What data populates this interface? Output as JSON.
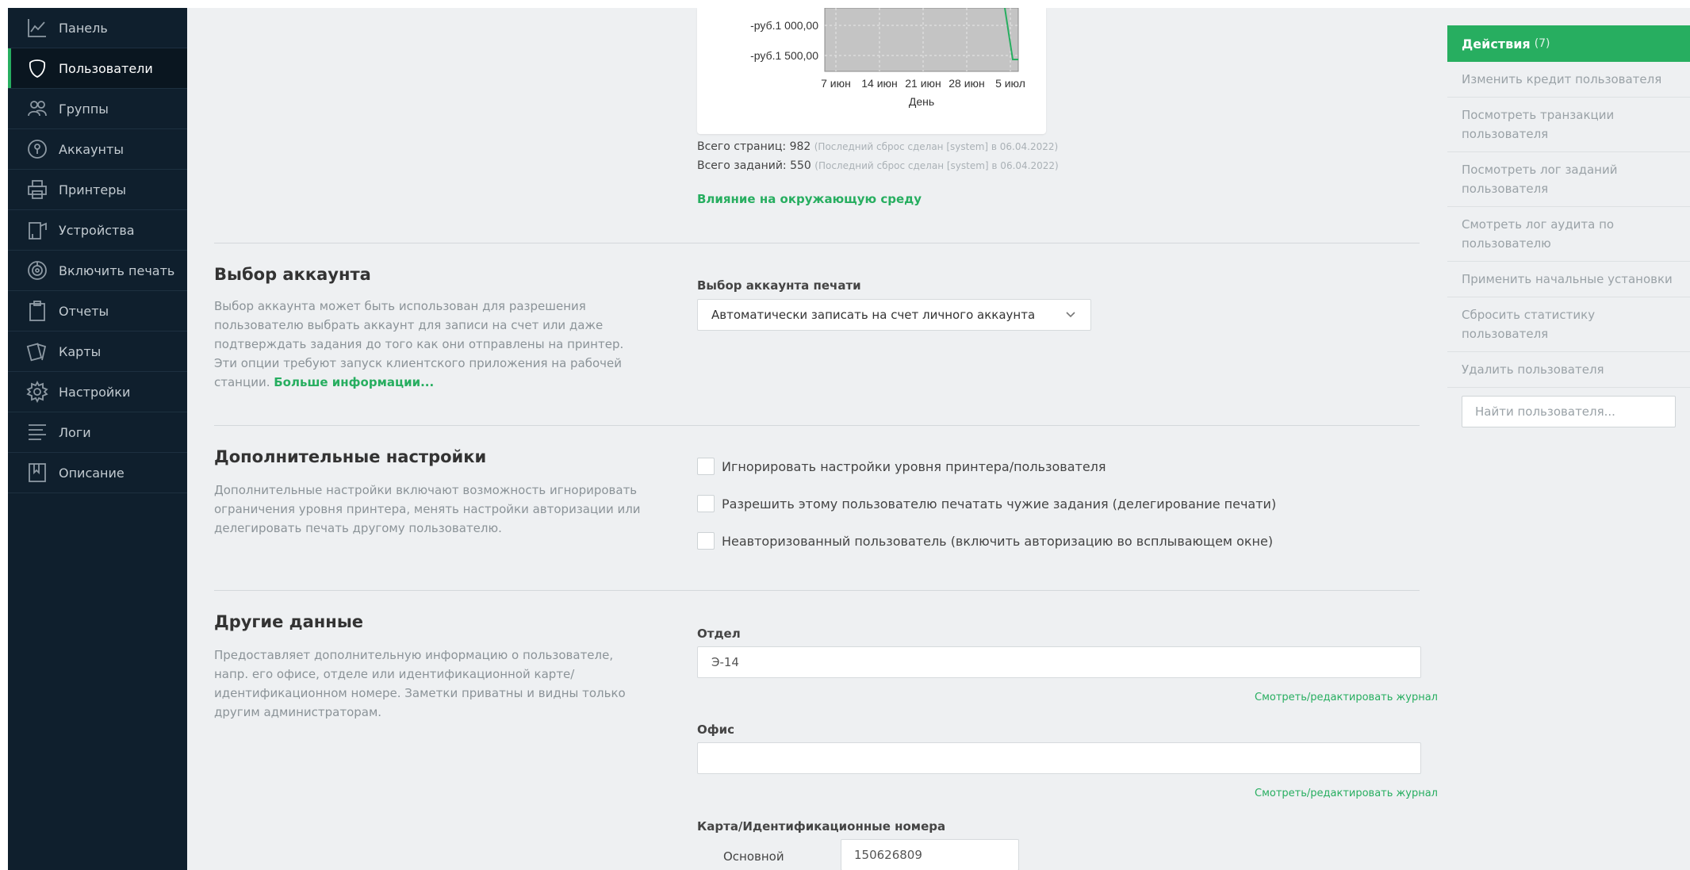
{
  "sidebar": {
    "items": [
      {
        "label": "Панель",
        "icon": "dashboard-icon"
      },
      {
        "label": "Пользователи",
        "icon": "users-icon"
      },
      {
        "label": "Группы",
        "icon": "groups-icon"
      },
      {
        "label": "Аккаунты",
        "icon": "accounts-icon"
      },
      {
        "label": "Принтеры",
        "icon": "printer-icon"
      },
      {
        "label": "Устройства",
        "icon": "devices-icon"
      },
      {
        "label": "Включить печать",
        "icon": "release-print-icon"
      },
      {
        "label": "Отчеты",
        "icon": "reports-icon"
      },
      {
        "label": "Карты",
        "icon": "cards-icon"
      },
      {
        "label": "Настройки",
        "icon": "settings-icon"
      },
      {
        "label": "Логи",
        "icon": "logs-icon"
      },
      {
        "label": "Описание",
        "icon": "about-icon"
      }
    ],
    "active": "Пользователи"
  },
  "chart_data": {
    "type": "line",
    "xlabel": "День",
    "x_ticks": [
      "7 июн",
      "14 июн",
      "21 июн",
      "28 июн",
      "5 июл"
    ],
    "y_ticks": [
      "-руб.1 000,00",
      "-руб.1 500,00"
    ],
    "series_color": "#27ae60"
  },
  "stats": {
    "pages_label": "Всего страниц:",
    "pages_value": "982",
    "pages_note": "(Последний сброс сделан [system] в 06.04.2022)",
    "jobs_label": "Всего заданий:",
    "jobs_value": "550",
    "jobs_note": "(Последний сброс сделан [system] в 06.04.2022)",
    "env_link": "Влияние на окружающую среду"
  },
  "account_selection": {
    "title": "Выбор аккаунта",
    "description": "Выбор аккаунта может быть использован для разрешения пользователю выбрать аккаунт для записи на счет или даже подтверждать задания до того как они отправлены на принтер. Эти опции требуют запуск клиентского приложения на рабочей станции.",
    "more_link": "Больше информации...",
    "field_label": "Выбор аккаунта печати",
    "selected_value": "Автоматически записать на счет личного аккаунта"
  },
  "advanced": {
    "title": "Дополнительные настройки",
    "description": "Дополнительные настройки включают возможность игнорировать ограничения уровня принтера, менять настройки авторизации или делегировать печать другому пользователю.",
    "checkboxes": [
      {
        "label": "Игнорировать настройки уровня принтера/пользователя",
        "checked": false
      },
      {
        "label": "Разрешить этому пользователю печатать чужие задания (делегирование печати)",
        "checked": false
      },
      {
        "label": "Неавторизованный пользователь (включить авторизацию во всплывающем окне)",
        "checked": false
      }
    ]
  },
  "other": {
    "title": "Другие данные",
    "description": "Предоставляет дополнительную информацию о пользователе, напр. его офисе, отделе или идентификационной карте/идентификационном номере. Заметки приватны и видны только другим администраторам.",
    "department_label": "Отдел",
    "department_value": "Э-14",
    "department_link": "Смотреть/редактировать журнал",
    "office_label": "Офис",
    "office_value": "",
    "office_link": "Смотреть/редактировать журнал",
    "card_label": "Карта/Идентификационные номера",
    "primary_label": "Основной",
    "primary_value": "150626809"
  },
  "actions": {
    "title": "Действия",
    "count": "(7)",
    "items": [
      "Изменить кредит пользователя",
      "Посмотреть транзакции пользователя",
      "Посмотреть лог заданий пользователя",
      "Смотреть лог аудита по пользователю",
      "Применить начальные установки",
      "Сбросить статистику пользователя",
      "Удалить пользователя"
    ],
    "search_placeholder": "Найти пользователя..."
  }
}
